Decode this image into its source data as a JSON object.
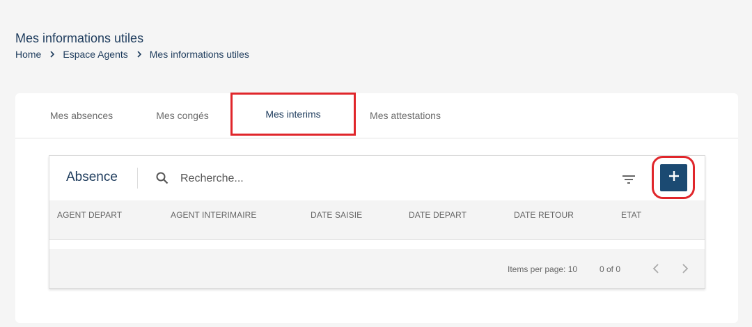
{
  "header": {
    "title": "Mes informations utiles",
    "breadcrumb": [
      "Home",
      "Espace Agents",
      "Mes informations utiles"
    ]
  },
  "tabs": [
    {
      "label": "Mes absences",
      "active": false
    },
    {
      "label": "Mes congés",
      "active": false
    },
    {
      "label": "Mes interims",
      "active": true
    },
    {
      "label": "Mes attestations",
      "active": false
    }
  ],
  "table": {
    "title": "Absence",
    "search_placeholder": "Recherche...",
    "columns": [
      "AGENT DEPART",
      "AGENT INTERIMAIRE",
      "DATE SAISIE",
      "DATE DEPART",
      "DATE RETOUR",
      "ETAT"
    ],
    "rows": [],
    "add_button_label": "+"
  },
  "paginator": {
    "items_per_page": "Items per page: 10",
    "range": "0 of 0"
  },
  "colors": {
    "accent": "#1b4a72",
    "highlight": "#e0262b",
    "text": "#1d3b5c"
  },
  "icons": [
    "chevron-right-icon",
    "search-icon",
    "filter-icon",
    "plus-icon",
    "chevron-left-icon"
  ]
}
